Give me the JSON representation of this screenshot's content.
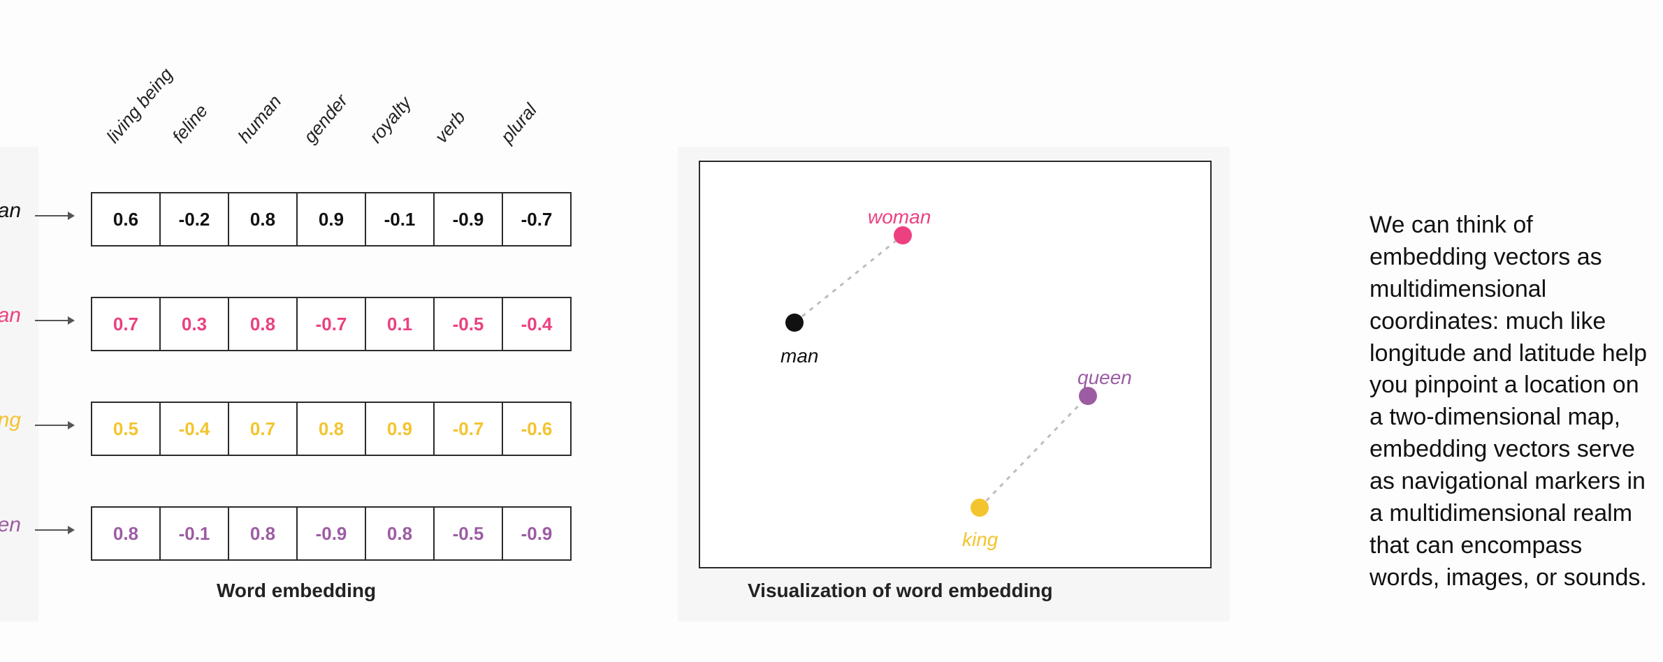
{
  "captions": {
    "word": "word",
    "word_embedding": "Word embedding",
    "viz": "Visualization of word embedding"
  },
  "columns": [
    "living being",
    "feline",
    "human",
    "gender",
    "royalty",
    "verb",
    "plural"
  ],
  "rows": [
    {
      "name": "man",
      "label": "man",
      "color": "c-man",
      "values": [
        "0.6",
        "-0.2",
        "0.8",
        "0.9",
        "-0.1",
        "-0.9",
        "-0.7"
      ]
    },
    {
      "name": "woman",
      "label": "woman",
      "color": "c-woman",
      "values": [
        "0.7",
        "0.3",
        "0.8",
        "-0.7",
        "0.1",
        "-0.5",
        "-0.4"
      ]
    },
    {
      "name": "king",
      "label": "king",
      "color": "c-king",
      "values": [
        "0.5",
        "-0.4",
        "0.7",
        "0.8",
        "0.9",
        "-0.7",
        "-0.6"
      ]
    },
    {
      "name": "queen",
      "label": "queen",
      "color": "c-queen",
      "values": [
        "0.8",
        "-0.1",
        "0.8",
        "-0.9",
        "0.8",
        "-0.5",
        "-0.9"
      ]
    }
  ],
  "viz": {
    "points": {
      "man": {
        "label": "man",
        "color": "#111111",
        "x": 135,
        "y": 230,
        "label_dx": -20,
        "label_dy": 32
      },
      "woman": {
        "label": "woman",
        "color": "#ec4081",
        "x": 290,
        "y": 105,
        "label_dx": -50,
        "label_dy": -42
      },
      "king": {
        "label": "king",
        "color": "#f3c42e",
        "x": 400,
        "y": 495,
        "label_dx": -25,
        "label_dy": 30
      },
      "queen": {
        "label": "queen",
        "color": "#9c5ca3",
        "x": 555,
        "y": 335,
        "label_dx": -15,
        "label_dy": -42
      }
    },
    "lines": [
      {
        "from": "man",
        "to": "woman"
      },
      {
        "from": "king",
        "to": "queen"
      }
    ]
  },
  "description": "We can think of embedding vectors as multidimensional coordinates: much like longitude and latitude help you pinpoint a location on a two-dimensional map, embedding vectors serve as navigational markers in a multidimensional realm that can encompass words, images, or sounds.",
  "chart_data": {
    "type": "table",
    "title": "Word embedding",
    "columns": [
      "living being",
      "feline",
      "human",
      "gender",
      "royalty",
      "verb",
      "plural"
    ],
    "series": [
      {
        "name": "man",
        "values": [
          0.6,
          -0.2,
          0.8,
          0.9,
          -0.1,
          -0.9,
          -0.7
        ]
      },
      {
        "name": "woman",
        "values": [
          0.7,
          0.3,
          0.8,
          -0.7,
          0.1,
          -0.5,
          -0.4
        ]
      },
      {
        "name": "king",
        "values": [
          0.5,
          -0.4,
          0.7,
          0.8,
          0.9,
          -0.7,
          -0.6
        ]
      },
      {
        "name": "queen",
        "values": [
          0.8,
          -0.1,
          0.8,
          -0.9,
          0.8,
          -0.5,
          -0.9
        ]
      }
    ]
  }
}
